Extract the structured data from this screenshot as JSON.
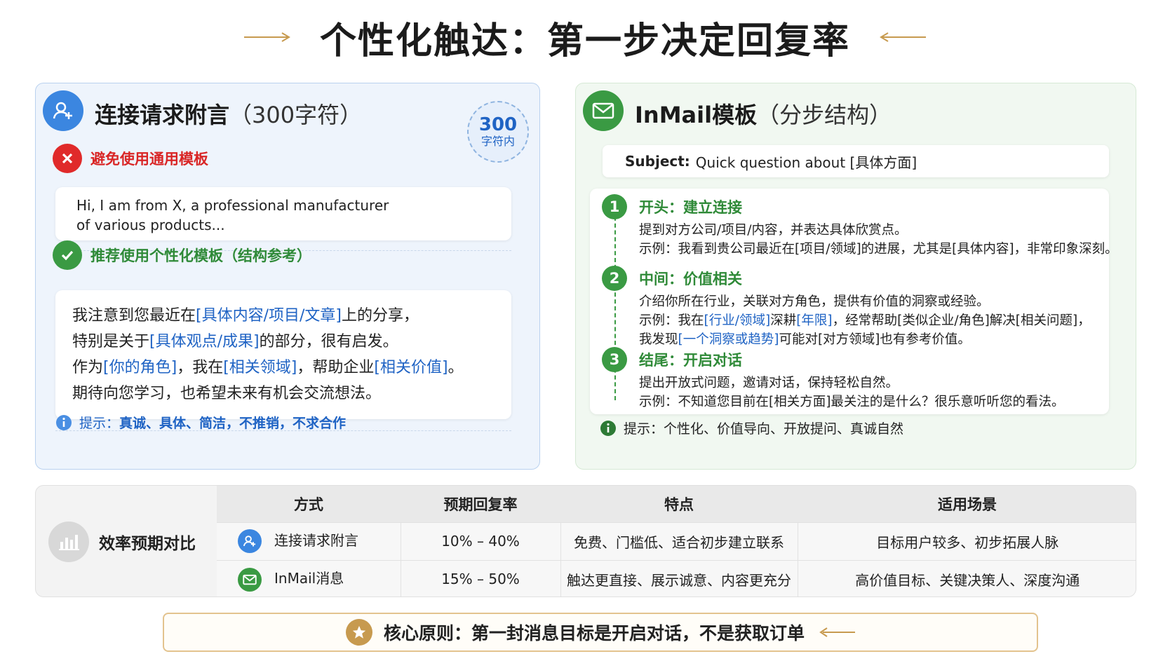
{
  "title": "个性化触达：第一步决定回复率",
  "colors": {
    "blue": "#1f63c4",
    "green": "#3a9a43",
    "red": "#d92626",
    "gold": "#c79a4f"
  },
  "left_card": {
    "heading": "连接请求附言",
    "heading_sub": "（300字符）",
    "badge_num": "300",
    "badge_label": "字符内",
    "avoid_label": "避免使用通用模板",
    "avoid_text": [
      "Hi, I am from X, a professional manufacturer",
      "of various products..."
    ],
    "recommend_label": "推荐使用个性化模板（结构参考）",
    "template_lines": [
      [
        {
          "t": "我注意到您最近在"
        },
        {
          "t": "[具体内容/项目/文章]",
          "hl": true
        },
        {
          "t": "上的分享，"
        }
      ],
      [
        {
          "t": "特别是关于"
        },
        {
          "t": "[具体观点/成果]",
          "hl": true
        },
        {
          "t": "的部分，很有启发。"
        }
      ],
      [
        {
          "t": "作为"
        },
        {
          "t": "[你的角色]",
          "hl": true
        },
        {
          "t": "，我在"
        },
        {
          "t": "[相关领域]",
          "hl": true
        },
        {
          "t": "，帮助企业"
        },
        {
          "t": "[相关价值]",
          "hl": true
        },
        {
          "t": "。"
        }
      ],
      [
        {
          "t": "期待向您学习，也希望未来有机会交流想法。"
        }
      ]
    ],
    "hint_prefix": "提示：",
    "hint_text": "真诚、具体、简洁，不推销，不求合作"
  },
  "right_card": {
    "heading": "InMail模板",
    "heading_sub": "（分步结构）",
    "subject_label": "Subject:",
    "subject_text": "Quick question about [具体方面]",
    "steps": [
      {
        "num": "1",
        "title": "开头：建立连接",
        "lines": [
          [
            {
              "t": "提到对方公司/项目/内容，并表达具体欣赏点。"
            }
          ],
          [
            {
              "t": "示例：我看到贵公司最近在[项目/领域]的进展，尤其是[具体内容]，非常印象深刻。"
            }
          ]
        ]
      },
      {
        "num": "2",
        "title": "中间：价值相关",
        "lines": [
          [
            {
              "t": "介绍你所在行业，关联对方角色，提供有价值的洞察或经验。"
            }
          ],
          [
            {
              "t": "示例：我在"
            },
            {
              "t": "[行业/领域]",
              "hl": true
            },
            {
              "t": "深耕"
            },
            {
              "t": "[年限]",
              "hl": true
            },
            {
              "t": "，经常帮助[类似企业/角色]解决[相关问题]，"
            }
          ],
          [
            {
              "t": "我发现"
            },
            {
              "t": "[一个洞察或趋势]",
              "hl": true
            },
            {
              "t": "可能对[对方领域]也有参考价值。"
            }
          ]
        ]
      },
      {
        "num": "3",
        "title": "结尾：开启对话",
        "lines": [
          [
            {
              "t": "提出开放式问题，邀请对话，保持轻松自然。"
            }
          ],
          [
            {
              "t": "示例：不知道您目前在[相关方面]最关注的是什么？很乐意听听您的看法。"
            }
          ]
        ]
      }
    ],
    "hint_prefix": "提示：",
    "hint_text": "个性化、价值导向、开放提问、真诚自然"
  },
  "comparison": {
    "label": "效率预期对比",
    "headers": [
      "方式",
      "预期回复率",
      "特点",
      "适用场景"
    ],
    "rows": [
      {
        "icon": "add-user-icon",
        "method": "连接请求附言",
        "rate": "10% – 40%",
        "feature": "免费、门槛低、适合初步建立联系",
        "scenario": "目标用户较多、初步拓展人脉"
      },
      {
        "icon": "mail-icon",
        "method": "InMail消息",
        "rate": "15% – 50%",
        "feature": "触达更直接、展示诚意、内容更充分",
        "scenario": "高价值目标、关键决策人、深度沟通"
      }
    ]
  },
  "principle": "核心原则：第一封消息目标是开启对话，不是获取订单"
}
